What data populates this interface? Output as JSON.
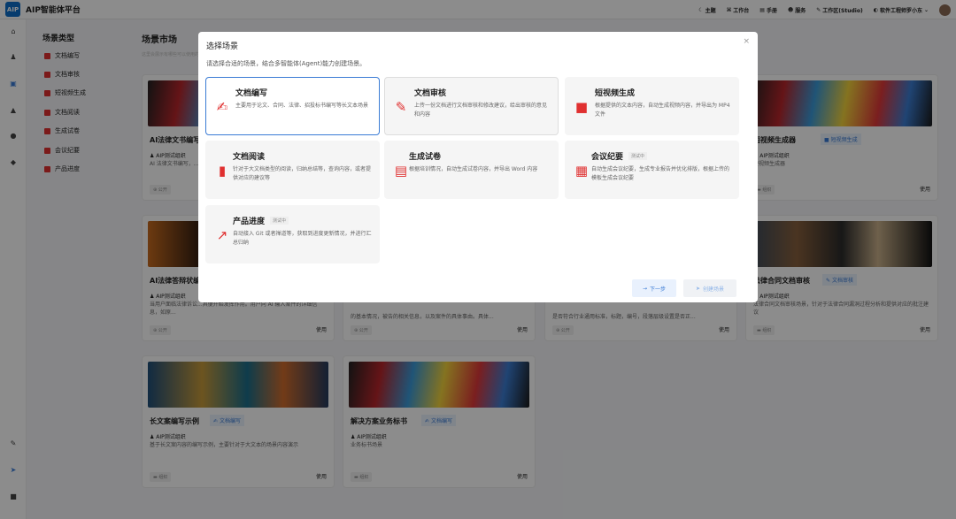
{
  "app": {
    "logo": "AIP",
    "title": "AIP智能体平台"
  },
  "topnav": [
    {
      "icon": "moon-icon",
      "glyph": "☾",
      "label": "主题"
    },
    {
      "icon": "workspace-icon",
      "glyph": "⌘",
      "label": "工作台"
    },
    {
      "icon": "manual-icon",
      "glyph": "▤",
      "label": "手册"
    },
    {
      "icon": "service-icon",
      "glyph": "☻",
      "label": "服务"
    },
    {
      "icon": "studio-icon",
      "glyph": "✎",
      "label": "工作区(Studio)"
    },
    {
      "icon": "org-icon",
      "glyph": "◐",
      "label": "软件工程师罗小东"
    }
  ],
  "sidebar": {
    "title": "场景类型",
    "items": [
      "文档编写",
      "文档审核",
      "短视频生成",
      "文档阅读",
      "生成试卷",
      "会议纪要",
      "产品进度"
    ]
  },
  "main": {
    "title": "场景市场",
    "subtitle": "这里会展示有哪些可以使用的场景"
  },
  "cards": [
    {
      "title": "AI法律文书编写",
      "tag": "",
      "org": "AIP测试组织",
      "desc": "AI 法律文书编写，...与法律要点，精准...",
      "visibility": "公开",
      "use": ""
    },
    {
      "title": "短视频生成器",
      "tag": "短视频生成",
      "org": "AIP测试组织",
      "desc": "短视频生成器",
      "visibility": "组织",
      "use": "使用"
    },
    {
      "title": "AI法律答辩状编写",
      "tag": "",
      "org": "AIP测试组织",
      "desc": "当用户面临法律诉讼...具便开始发挥作用。用户向 AI 输入案件的详细信息，如原...",
      "visibility": "公开",
      "use": "使用"
    },
    {
      "title": "",
      "tag": "",
      "org": "",
      "desc": "的基本情况，被告的相关信息，以及案件的具体事由。具体...",
      "visibility": "公开",
      "use": "使用"
    },
    {
      "title": "",
      "tag": "",
      "org": "",
      "desc": "是否符合行业通用标准，标题，编号，段落层级设置是否正...",
      "visibility": "公开",
      "use": "使用"
    },
    {
      "title": "法律合同文档审核",
      "tag": "文档审核",
      "org": "AIP测试组织",
      "desc": "法律合同文档审核场景，针对于法律合同漏洞过程分析和提供对应的批注建议",
      "visibility": "组织",
      "use": "使用"
    },
    {
      "title": "长文案编写示例",
      "tag": "文档编写",
      "org": "AIP测试组织",
      "desc": "基于长文案内容的编写示例，主要针对于大文本的场景内容演示",
      "visibility": "组织",
      "use": "使用"
    },
    {
      "title": "解决方案业务标书",
      "tag": "文档编写",
      "org": "AIP测试组织",
      "desc": "业务标书场景",
      "visibility": "组织",
      "use": "使用"
    }
  ],
  "modal": {
    "title": "选择场景",
    "close": "×",
    "subtitle": "请选择合适的场景，结合多智能体(Agent)能力创建场景。",
    "options": [
      {
        "title": "文档编写",
        "beta": "",
        "desc": "主要用于论文、合同、法律、招投标书编写等长文本场景",
        "icon": "document-write-icon",
        "glyph": "✍"
      },
      {
        "title": "文档审核",
        "beta": "",
        "desc": "上传一份文档进行文档审核和修改建议，给出审核的意见和内容",
        "icon": "document-review-icon",
        "glyph": "✎"
      },
      {
        "title": "短视频生成",
        "beta": "",
        "desc": "根据提供的文本内容，自动生成视频内容，并导出为 MP4 文件",
        "icon": "video-icon",
        "glyph": "■"
      },
      {
        "title": "文档阅读",
        "beta": "",
        "desc": "针对于大文档类型的阅读，归纳总结等，查询内容，或者提供对应的建议等",
        "icon": "book-icon",
        "glyph": "▮"
      },
      {
        "title": "生成试卷",
        "beta": "",
        "desc": "根据培训情况，自动生成试卷内容，并导出 Word 内容",
        "icon": "exam-icon",
        "glyph": "▤"
      },
      {
        "title": "会议纪要",
        "beta": "测试中",
        "desc": "自动生成会议纪要，生成专业报告并优化排版，根据上传的模板生成会议纪要",
        "icon": "calendar-icon",
        "glyph": "▦"
      },
      {
        "title": "产品进度",
        "beta": "测试中",
        "desc": "自动接入 Git 或者禅道等，获取到进度更新情况，并进行汇总归纳",
        "icon": "chart-icon",
        "glyph": "↗"
      }
    ],
    "next": "下一步",
    "create": "创建场景"
  }
}
